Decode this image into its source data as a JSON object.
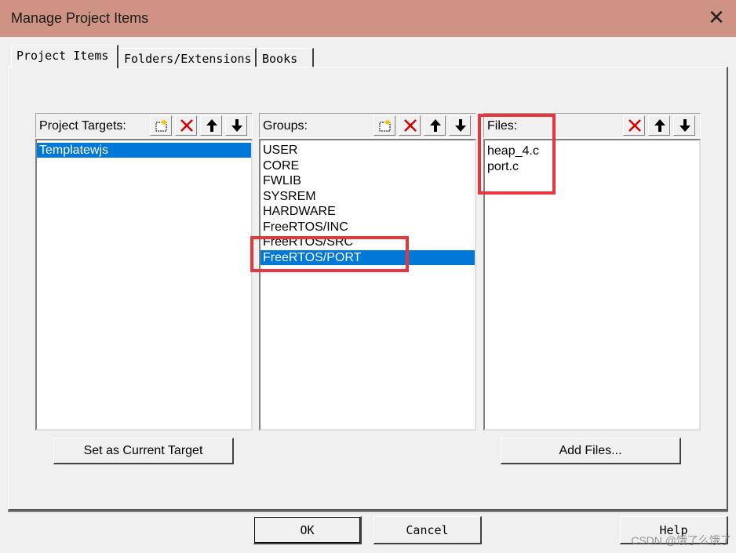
{
  "window": {
    "title": "Manage Project Items",
    "close_glyph": "✕"
  },
  "tabs": [
    {
      "label": "Project Items",
      "active": true
    },
    {
      "label": "Folders/Extensions",
      "active": false
    },
    {
      "label": "Books",
      "active": false
    }
  ],
  "targets": {
    "header": "Project Targets:",
    "items": [
      "Templatewjs"
    ],
    "selected_index": 0
  },
  "groups": {
    "header": "Groups:",
    "items": [
      "USER",
      "CORE",
      "FWLIB",
      "SYSREM",
      "HARDWARE",
      "FreeRTOS/INC",
      "FreeRTOS/SRC",
      "FreeRTOS/PORT"
    ],
    "selected_index": 7
  },
  "files": {
    "header": "Files:",
    "items": [
      "heap_4.c",
      "port.c"
    ]
  },
  "buttons": {
    "set_target": "Set as Current Target",
    "add_files": "Add Files...",
    "ok": "OK",
    "cancel": "Cancel",
    "help": "Help"
  },
  "icons": {
    "new": "new-item-icon",
    "delete": "delete-icon",
    "up": "move-up-icon",
    "down": "move-down-icon"
  },
  "colors": {
    "selection": "#0078d7",
    "highlight_box": "#e8363d",
    "title_bar": "#cf9383"
  },
  "watermark": "CSDN @饿了么饿了"
}
